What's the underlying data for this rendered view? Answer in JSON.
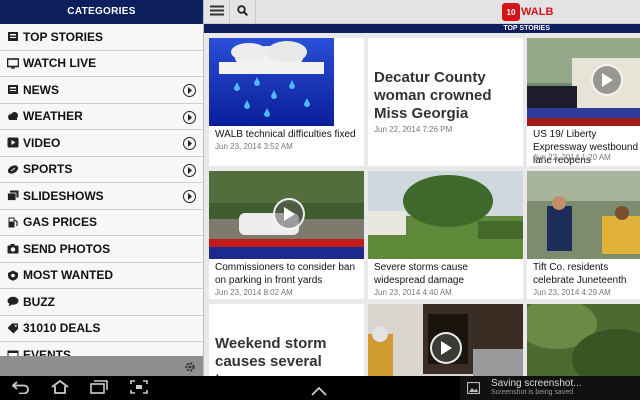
{
  "sidebar": {
    "header": "CATEGORIES",
    "items": [
      {
        "label": "TOP STORIES",
        "icon": "newspaper-icon",
        "has_arrow": false
      },
      {
        "label": "WATCH LIVE",
        "icon": "tv-icon",
        "has_arrow": false
      },
      {
        "label": "NEWS",
        "icon": "newspaper-icon",
        "has_arrow": true
      },
      {
        "label": "WEATHER",
        "icon": "cloud-icon",
        "has_arrow": true
      },
      {
        "label": "VIDEO",
        "icon": "play-icon",
        "has_arrow": true
      },
      {
        "label": "SPORTS",
        "icon": "football-icon",
        "has_arrow": true
      },
      {
        "label": "SLIDESHOWS",
        "icon": "slides-icon",
        "has_arrow": true
      },
      {
        "label": "GAS PRICES",
        "icon": "gas-icon",
        "has_arrow": false
      },
      {
        "label": "SEND PHOTOS",
        "icon": "camera-icon",
        "has_arrow": false
      },
      {
        "label": "MOST WANTED",
        "icon": "badge-icon",
        "has_arrow": false
      },
      {
        "label": "BUZZ",
        "icon": "chat-icon",
        "has_arrow": false
      },
      {
        "label": "31010 DEALS",
        "icon": "tag-icon",
        "has_arrow": false
      },
      {
        "label": "EVENTS",
        "icon": "calendar-icon",
        "has_arrow": false
      }
    ]
  },
  "header": {
    "logo_number": "10",
    "logo_name": "WALB",
    "section": "TOP STORIES"
  },
  "cards": [
    {
      "caption": "WALB technical difficulties fixed",
      "date": "Jun 23, 2014 3:52 AM",
      "video": false
    },
    {
      "caption": "Decatur County woman crowned Miss Georgia",
      "date": "Jun 22, 2014 7:26 PM",
      "video": false
    },
    {
      "caption": "US 19/ Liberty Expressway westbound lane reopens",
      "date": "Jun 22, 2014 1:20 AM",
      "video": true
    },
    {
      "caption": "Commissioners to consider ban on parking in front yards",
      "date": "Jun 23, 2014 8:02 AM",
      "video": true
    },
    {
      "caption": "Severe storms cause widespread damage",
      "date": "Jun 23, 2014 4:40 AM",
      "video": false
    },
    {
      "caption": "Tift Co. residents celebrate Juneteenth",
      "date": "Jun 23, 2014 4:29 AM",
      "video": false
    },
    {
      "caption": "Weekend storm causes several trees",
      "date": "",
      "video": false
    },
    {
      "caption": "",
      "date": "",
      "video": true
    },
    {
      "caption": "",
      "date": "",
      "video": false
    }
  ],
  "notification": {
    "title": "Saving screenshot...",
    "subtitle": "Screenshot is being saved"
  },
  "colors": {
    "brand_red": "#d4141a",
    "navy": "#0d1f5c"
  }
}
